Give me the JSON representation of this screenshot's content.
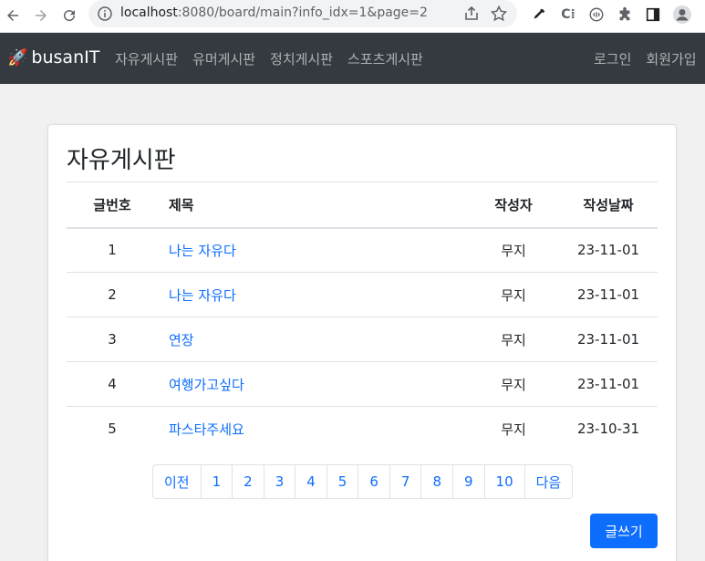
{
  "browser": {
    "url_host": "localhost",
    "url_path": ":8080/board/main?info_idx=1&page=2"
  },
  "navbar": {
    "brand_icon": "🚀",
    "brand": "busanIT",
    "links": [
      "자유게시판",
      "유머게시판",
      "정치게시판",
      "스포츠게시판"
    ],
    "right": [
      "로그인",
      "회원가입"
    ]
  },
  "board": {
    "title": "자유게시판",
    "columns": [
      "글번호",
      "제목",
      "작성자",
      "작성날짜"
    ],
    "rows": [
      {
        "num": "1",
        "title": "나는 자유다",
        "writer": "무지",
        "date": "23-11-01"
      },
      {
        "num": "2",
        "title": "나는 자유다",
        "writer": "무지",
        "date": "23-11-01"
      },
      {
        "num": "3",
        "title": "연장",
        "writer": "무지",
        "date": "23-11-01"
      },
      {
        "num": "4",
        "title": "여행가고싶다",
        "writer": "무지",
        "date": "23-11-01"
      },
      {
        "num": "5",
        "title": "파스타주세요",
        "writer": "무지",
        "date": "23-10-31"
      }
    ],
    "pagination": [
      "이전",
      "1",
      "2",
      "3",
      "4",
      "5",
      "6",
      "7",
      "8",
      "9",
      "10",
      "다음"
    ],
    "write_button": "글쓰기"
  },
  "colors": {
    "navbar_bg": "#343a40",
    "link": "#0d6efd",
    "primary": "#0d6efd"
  }
}
